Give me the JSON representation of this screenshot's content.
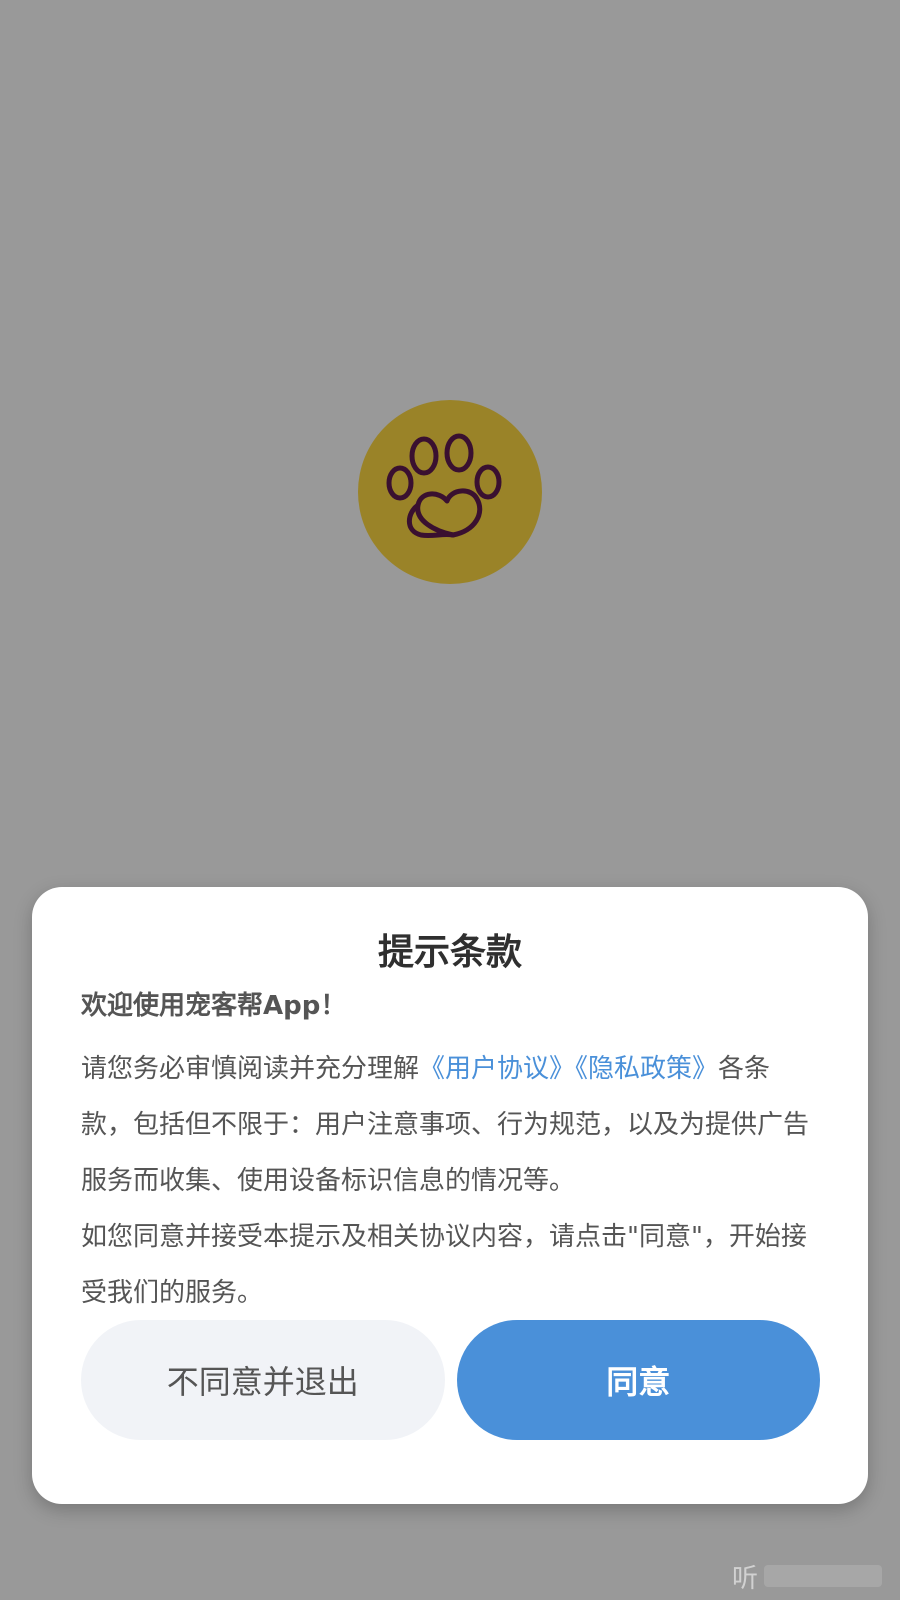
{
  "logo": {
    "icon": "paw-heart-icon",
    "background_color": "#9a8328",
    "stroke_color": "#3a1030"
  },
  "dialog": {
    "title": "提示条款",
    "welcome": "欢迎使用宠客帮App！",
    "paragraph1": {
      "prefix": "请您务必审慎阅读并充分理解",
      "link_user_agreement": "《用户协议》",
      "link_privacy_policy": "《隐私政策》",
      "suffix": "各条款，包括但不限于：用户注意事项、行为规范，以及为提供广告服务而收集、使用设备标识信息的情况等。"
    },
    "paragraph2": "如您同意并接受本提示及相关协议内容，请点击\"同意\"，开始接受我们的服务。",
    "decline_button": "不同意并退出",
    "agree_button": "同意"
  },
  "colors": {
    "overlay": "#999999",
    "accent": "#4a90d9",
    "decline_bg": "#f1f3f7"
  },
  "watermark": {
    "glyph": "听"
  }
}
